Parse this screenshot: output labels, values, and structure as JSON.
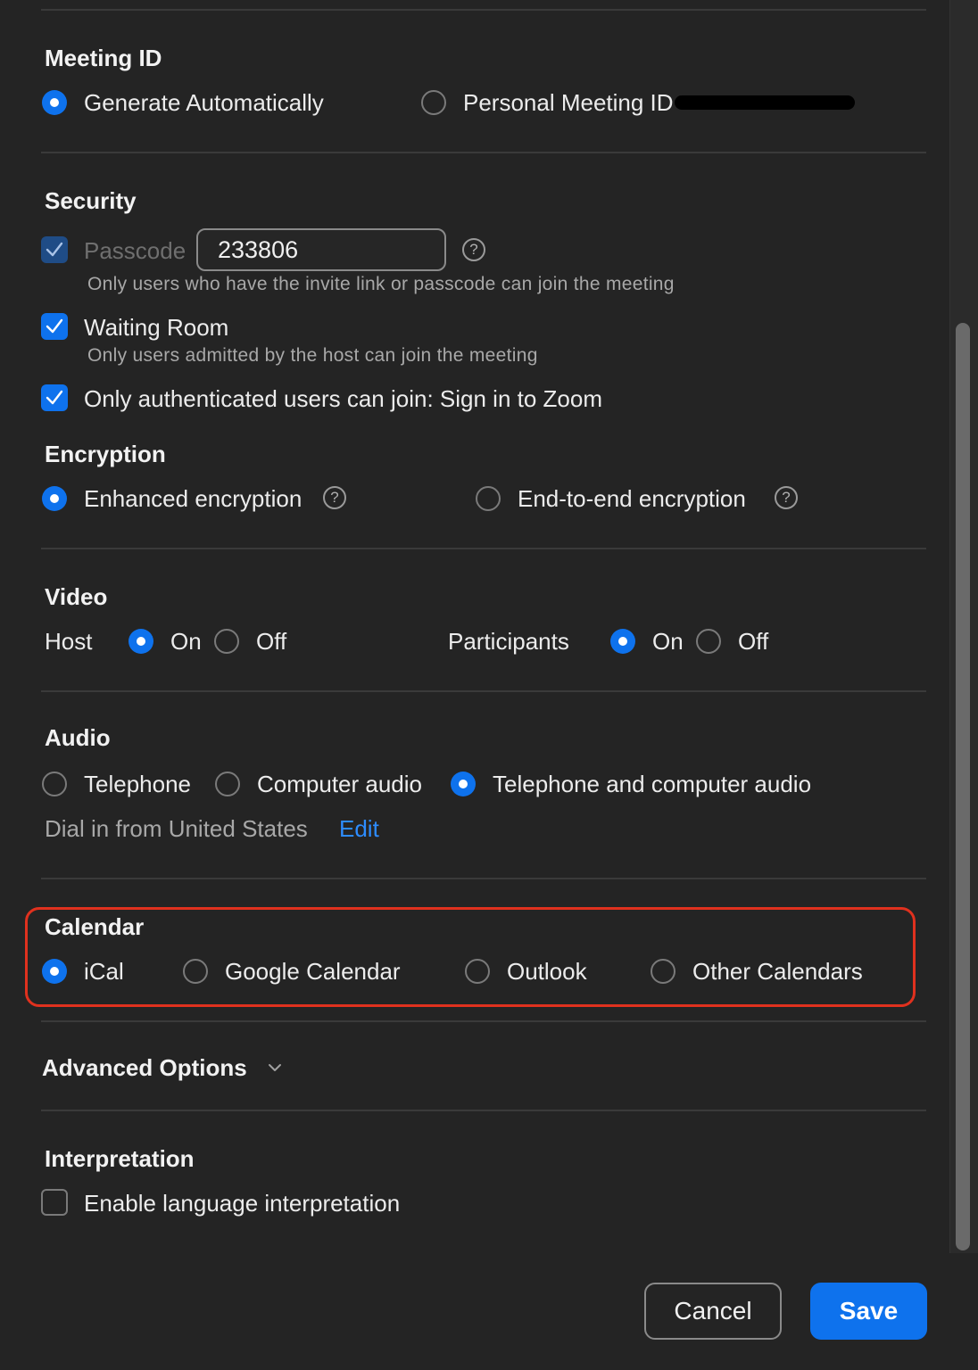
{
  "meeting_id": {
    "title": "Meeting ID",
    "options": [
      {
        "label": "Generate Automatically",
        "selected": true
      },
      {
        "label": "Personal Meeting ID",
        "selected": false
      }
    ]
  },
  "security": {
    "title": "Security",
    "passcode_label": "Passcode",
    "passcode_value": "233806",
    "passcode_help": "?",
    "passcode_desc": "Only users who have the invite link or passcode can join the meeting",
    "waiting_room_label": "Waiting Room",
    "waiting_room_desc": "Only users admitted by the host can join the meeting",
    "auth_label": "Only authenticated users can join: Sign in to Zoom"
  },
  "encryption": {
    "title": "Encryption",
    "options": [
      {
        "label": "Enhanced encryption",
        "selected": true
      },
      {
        "label": "End-to-end encryption",
        "selected": false
      }
    ],
    "help": "?"
  },
  "video": {
    "title": "Video",
    "host_label": "Host",
    "participants_label": "Participants",
    "on_label": "On",
    "off_label": "Off",
    "host": "On",
    "participants": "On"
  },
  "audio": {
    "title": "Audio",
    "options": [
      {
        "label": "Telephone",
        "selected": false
      },
      {
        "label": "Computer audio",
        "selected": false
      },
      {
        "label": "Telephone and computer audio",
        "selected": true
      }
    ],
    "dial_in_text": "Dial in from United States",
    "edit_label": "Edit"
  },
  "calendar": {
    "title": "Calendar",
    "options": [
      {
        "label": "iCal",
        "selected": true
      },
      {
        "label": "Google Calendar",
        "selected": false
      },
      {
        "label": "Outlook",
        "selected": false
      },
      {
        "label": "Other Calendars",
        "selected": false
      }
    ],
    "highlight_color": "#e0311e"
  },
  "advanced": {
    "title": "Advanced Options",
    "icon": "chevron-down-icon"
  },
  "interpretation": {
    "title": "Interpretation",
    "checkbox_label": "Enable language interpretation",
    "checked": false
  },
  "footer": {
    "cancel_label": "Cancel",
    "save_label": "Save"
  },
  "colors": {
    "background": "#242424",
    "accent": "#0e72ed",
    "link": "#2d8cff"
  }
}
